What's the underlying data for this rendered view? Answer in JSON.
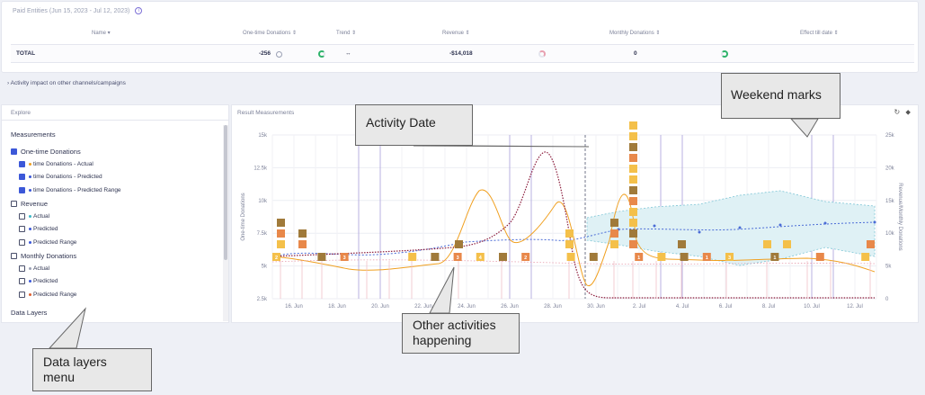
{
  "paid_entities": {
    "title": "Paid Entities",
    "date_range": "(Jun 15, 2023 - Jul 12, 2023)",
    "columns": [
      "Name ▾",
      "One-time Donations ⇕",
      "Trend ⇕",
      "Revenue ⇕",
      "Monthly Donations ⇕",
      "Effect till date ⇕"
    ],
    "total_row": {
      "label": "TOTAL",
      "one_time": "-256",
      "trend": "↔",
      "revenue": "-$14,018",
      "monthly": "0"
    }
  },
  "activity_impact": "›  Activity impact on other channels/campaigns",
  "explore": {
    "title": "Explore",
    "measurements_heading": "Measurements",
    "items": [
      {
        "label": "One-time Donations",
        "checked": true,
        "level": 0
      },
      {
        "label": "time Donations - Actual",
        "checked": true,
        "level": 1,
        "color": "#f0a020"
      },
      {
        "label": "time Donations - Predicted",
        "checked": true,
        "level": 1,
        "color": "#3c58d8"
      },
      {
        "label": "time Donations - Predicted Range",
        "checked": true,
        "level": 1,
        "color": "#3c58d8"
      },
      {
        "label": "Revenue",
        "checked": false,
        "level": 0
      },
      {
        "label": "Actual",
        "checked": false,
        "level": 1,
        "color": "#3cb8c8"
      },
      {
        "label": "Predicted",
        "checked": false,
        "level": 1,
        "color": "#3c58d8"
      },
      {
        "label": "Predicted Range",
        "checked": false,
        "level": 1,
        "color": "#3c58d8"
      },
      {
        "label": "Monthly Donations",
        "checked": false,
        "level": 0
      },
      {
        "label": "Actual",
        "checked": false,
        "level": 1,
        "color": "#9aa0b4"
      },
      {
        "label": "Predicted",
        "checked": false,
        "level": 1,
        "color": "#3c58d8"
      },
      {
        "label": "Predicted Range",
        "checked": false,
        "level": 1,
        "color": "#e06030"
      }
    ],
    "data_layers_heading": "Data Layers"
  },
  "results": {
    "title": "Result Measurements",
    "tools": "↻ ⬥"
  },
  "chart_data": {
    "type": "line",
    "left_axis_label": "One-time Donations",
    "right_axis_label": "Revenue/Monthly Donations",
    "y_left_ticks": [
      "15k",
      "12.5k",
      "10k",
      "7.5k",
      "5k",
      "2.5k"
    ],
    "y_right_ticks": [
      "25k",
      "20k",
      "15k",
      "10k",
      "5k",
      "0"
    ],
    "x_ticks": [
      "16. Jun",
      "18. Jun",
      "20. Jun",
      "22. Jun",
      "24. Jun",
      "26. Jun",
      "28. Jun",
      "30. Jun",
      "2. Jul",
      "4. Jul",
      "6. Jul",
      "8. Jul",
      "10. Jul",
      "12. Jul"
    ],
    "activity_markers": [
      {
        "day": 0,
        "label": "2"
      },
      {
        "day": 2,
        "label": ""
      },
      {
        "day": 3,
        "label": "3"
      },
      {
        "day": 6,
        "label": ""
      },
      {
        "day": 7,
        "label": ""
      },
      {
        "day": 8,
        "label": "3"
      },
      {
        "day": 9,
        "label": "4"
      },
      {
        "day": 10,
        "label": ""
      },
      {
        "day": 11,
        "label": "2"
      },
      {
        "day": 13,
        "label": ""
      },
      {
        "day": 14,
        "label": ""
      },
      {
        "day": 16,
        "label": "1"
      },
      {
        "day": 17,
        "label": ""
      },
      {
        "day": 18,
        "label": ""
      },
      {
        "day": 19,
        "label": "1"
      },
      {
        "day": 20,
        "label": "3"
      },
      {
        "day": 22,
        "label": "1"
      },
      {
        "day": 24,
        "label": ""
      },
      {
        "day": 26,
        "label": ""
      },
      {
        "day": 27,
        "label": ""
      }
    ]
  },
  "callouts": {
    "activity_date": "Activity Date",
    "weekend_marks": "Weekend marks",
    "other_activities_line1": "Other activities",
    "other_activities_line2": "happening",
    "data_layers_line1": "Data layers",
    "data_layers_line2": "menu"
  }
}
